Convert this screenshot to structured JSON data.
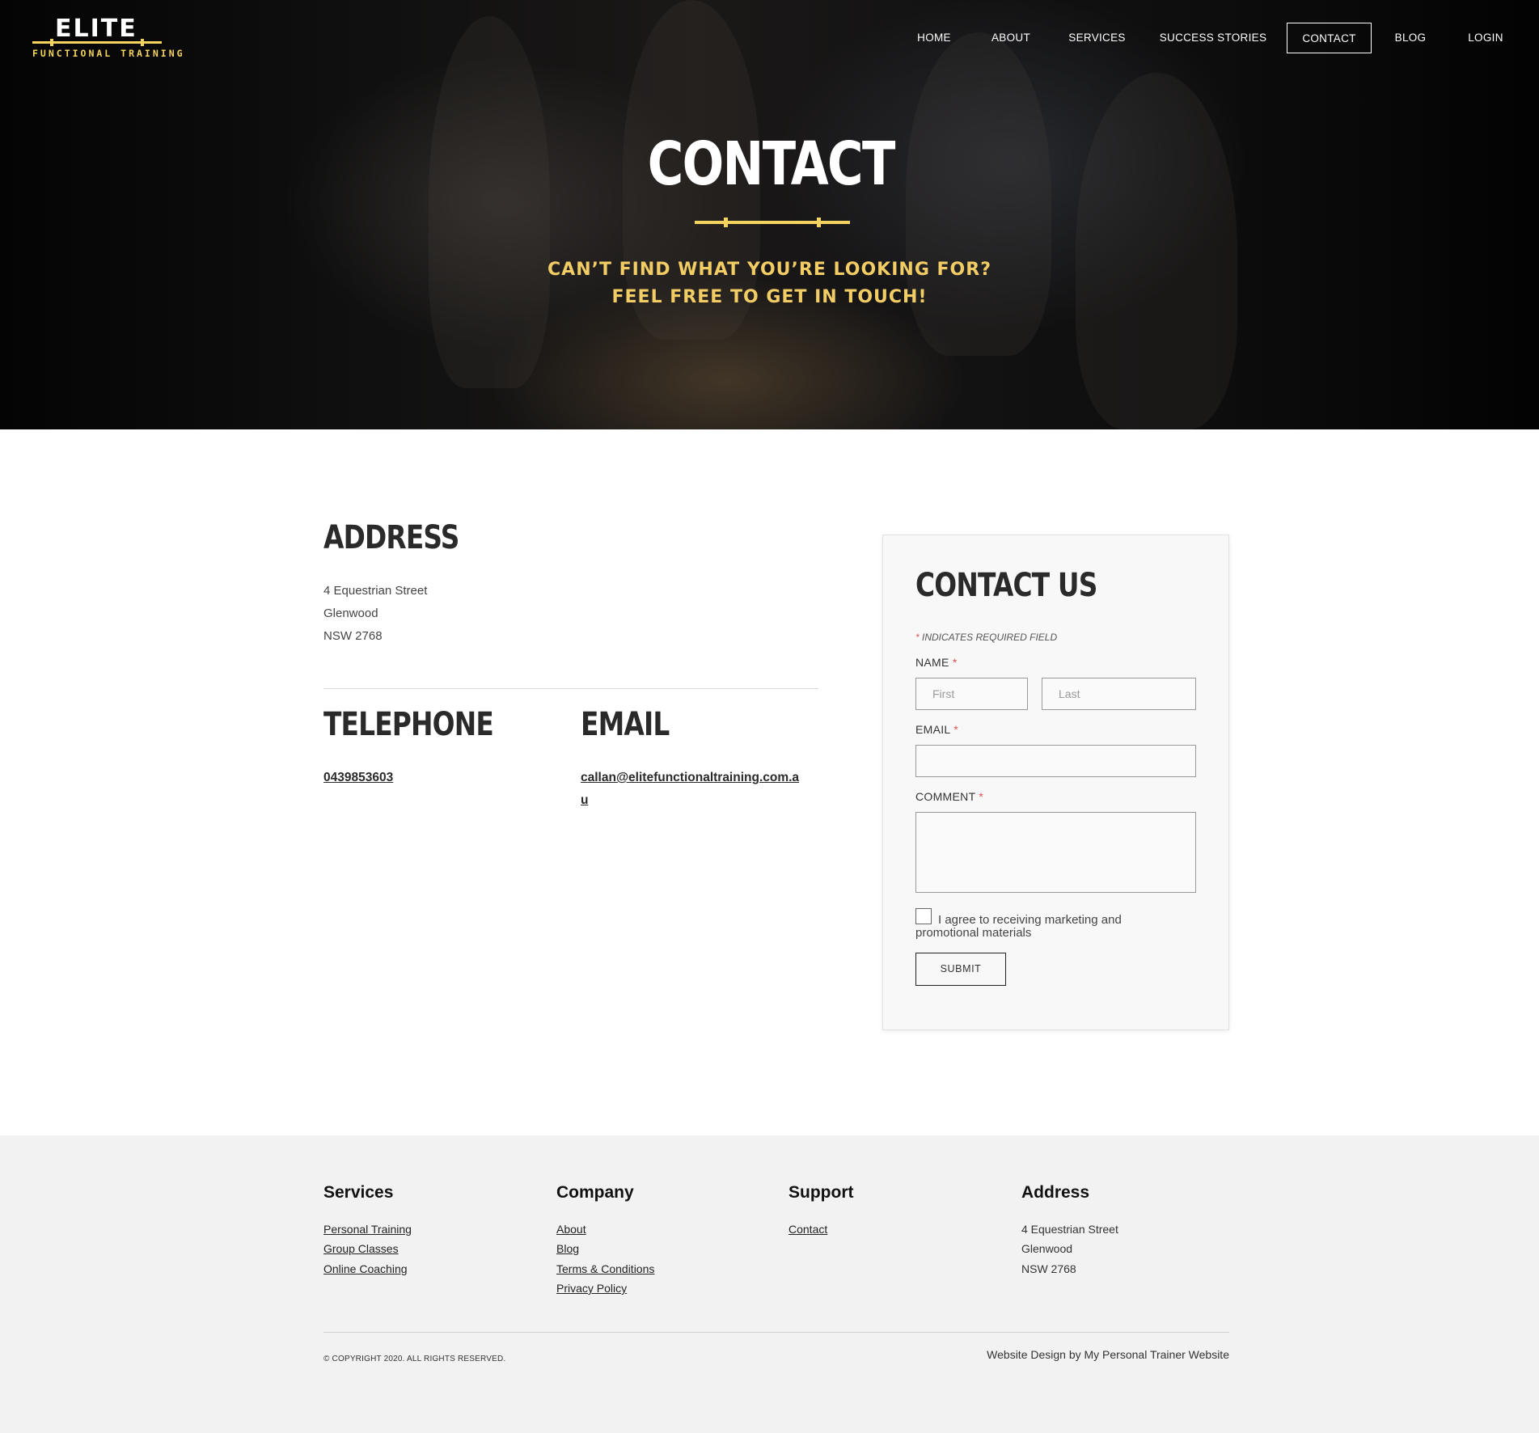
{
  "brand": {
    "name": "ELITE",
    "tagline": "FUNCTIONAL TRAINING",
    "accent_color": "#f4d35e"
  },
  "nav": {
    "items": [
      {
        "label": "HOME",
        "active": false
      },
      {
        "label": "ABOUT",
        "active": false
      },
      {
        "label": "SERVICES",
        "active": false
      },
      {
        "label": "SUCCESS STORIES",
        "active": false
      },
      {
        "label": "CONTACT",
        "active": true
      },
      {
        "label": "BLOG",
        "active": false
      },
      {
        "label": "LOGIN",
        "active": false
      }
    ]
  },
  "hero": {
    "title": "CONTACT",
    "subtitle_line1": "CAN’T FIND WHAT YOU’RE LOOKING FOR?",
    "subtitle_line2": "FEEL FREE TO GET IN TOUCH!"
  },
  "address": {
    "heading": "ADDRESS",
    "line1": "4 Equestrian Street",
    "line2": "Glenwood",
    "line3": "NSW 2768"
  },
  "telephone": {
    "heading": "TELEPHONE",
    "number": "0439853603"
  },
  "email": {
    "heading": "EMAIL",
    "address_line1": "callan@elitefunctionaltraining.com.a",
    "address_line2": "u"
  },
  "form": {
    "title": "CONTACT US",
    "required_star": "*",
    "required_note": "INDICATES REQUIRED FIELD",
    "name_label": "NAME",
    "first_placeholder": "First",
    "last_placeholder": "Last",
    "email_label": "EMAIL",
    "comment_label": "COMMENT",
    "consent_label": "I agree to receiving marketing and promotional materials",
    "submit_label": "SUBMIT"
  },
  "footer": {
    "services": {
      "heading": "Services",
      "links": [
        "Personal Training",
        "Group Classes",
        "Online Coaching"
      ]
    },
    "company": {
      "heading": "Company",
      "links": [
        "About",
        "Blog",
        "Terms & Conditions",
        "Privacy Policy"
      ]
    },
    "support": {
      "heading": "Support",
      "links": [
        "Contact"
      ]
    },
    "address": {
      "heading": "Address",
      "lines": [
        "4 Equestrian Street",
        "Glenwood",
        "NSW 2768"
      ]
    },
    "copyright": "© COPYRIGHT 2020. ALL RIGHTS RESERVED.",
    "credit": "Website Design by My Personal Trainer Website"
  }
}
